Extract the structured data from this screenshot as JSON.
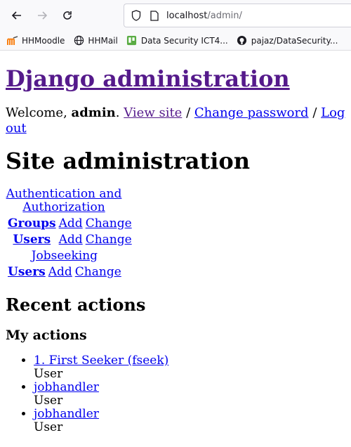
{
  "browser": {
    "url_host": "localhost",
    "url_path": "/admin/",
    "bookmarks": [
      {
        "label": "HHMoodle",
        "icon": "moodle-icon"
      },
      {
        "label": "HHMail",
        "icon": "globe-icon"
      },
      {
        "label": "Data Security ICT4...",
        "icon": "trello-icon"
      },
      {
        "label": "pajaz/DataSecurity...",
        "icon": "github-icon"
      }
    ]
  },
  "header": {
    "site_name": "Django administration",
    "welcome_prefix": "Welcome, ",
    "username": "admin",
    "welcome_dot": ".",
    "view_site": "View site",
    "separator": "/",
    "change_password": "Change password",
    "log_out": "Log out"
  },
  "main": {
    "title": "Site administration",
    "apps": [
      {
        "caption": "Authentication and Authorization",
        "models": [
          {
            "name": "Groups",
            "add": "Add",
            "change": "Change"
          },
          {
            "name": "Users",
            "add": "Add",
            "change": "Change"
          }
        ]
      },
      {
        "caption": "Jobseeking",
        "models": [
          {
            "name": "Users",
            "add": "Add",
            "change": "Change"
          }
        ]
      }
    ]
  },
  "recent": {
    "title": "Recent actions",
    "subtitle": "My actions",
    "items": [
      {
        "link": "1. First Seeker (fseek)",
        "type": "User"
      },
      {
        "link": "jobhandler",
        "type": "User"
      },
      {
        "link": "jobhandler",
        "type": "User"
      }
    ]
  }
}
